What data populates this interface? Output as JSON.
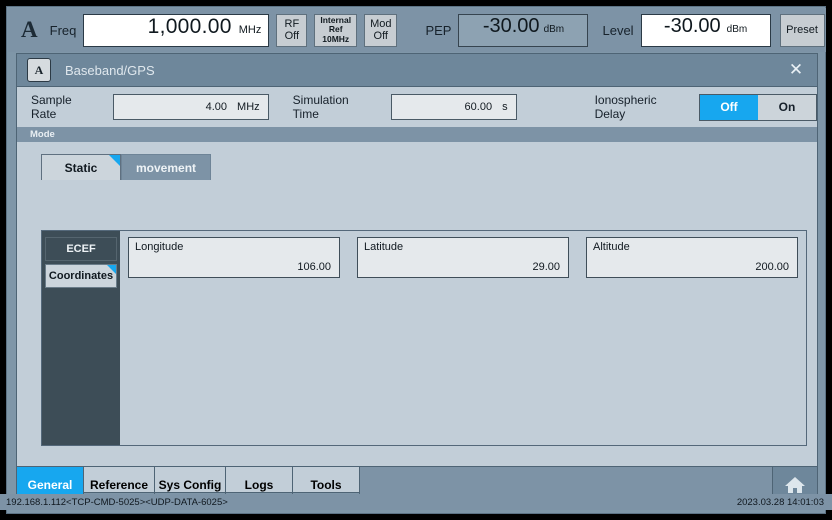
{
  "topbar": {
    "channel": "A",
    "freq_label": "Freq",
    "freq_value": "1,000.00",
    "freq_unit": "MHz",
    "rf_btn": "RF\nOff",
    "rf_line1": "RF",
    "rf_line2": "Off",
    "ref_line1": "Internal",
    "ref_line2": "Ref",
    "ref_line3": "10MHz",
    "mod_line1": "Mod",
    "mod_line2": "Off",
    "pep_label": "PEP",
    "pep_value": "-30.00",
    "pep_unit": "dBm",
    "level_label": "Level",
    "level_value": "-30.00",
    "level_unit": "dBm",
    "preset_label": "Preset"
  },
  "dialog": {
    "badge": "A",
    "title": "Baseband/GPS",
    "close_icon": "✕"
  },
  "settings": {
    "sample_rate_label": "Sample Rate",
    "sample_rate_value": "4.00",
    "sample_rate_unit": "MHz",
    "sim_time_label": "Simulation Time",
    "sim_time_value": "60.00",
    "sim_time_unit": "s",
    "iono_label": "Ionospheric Delay",
    "iono_off": "Off",
    "iono_on": "On",
    "iono_selected": "Off"
  },
  "mode": {
    "header": "Mode",
    "tabs": [
      {
        "label": "Static",
        "active": true
      },
      {
        "label": "movement",
        "active": false
      }
    ]
  },
  "sidetabs": [
    {
      "label": "ECEF",
      "active": false
    },
    {
      "label": "Coordinates",
      "active": true
    }
  ],
  "fields": [
    {
      "caption": "Longitude",
      "value": "106.00"
    },
    {
      "caption": "Latitude",
      "value": "29.00"
    },
    {
      "caption": "Altitude",
      "value": "200.00"
    }
  ],
  "waveform_button": {
    "icon": "waveform-icon"
  },
  "bottom_tabs": [
    {
      "label": "General",
      "active": true
    },
    {
      "label": "Reference",
      "active": false
    },
    {
      "label": "Sys Config",
      "active": false
    },
    {
      "label": "Logs",
      "active": false
    },
    {
      "label": "Tools",
      "active": false
    }
  ],
  "home_button": {
    "icon": "home-icon"
  },
  "statusbar": {
    "connection": "192.168.1.112<TCP-CMD-5025><UDP-DATA-6025>",
    "datetime": "2023.03.28 14:01:03"
  },
  "colors": {
    "accent": "#17a7ef",
    "panel": "#c2ced8",
    "chrome": "#7d93a6",
    "dark_sidebar": "#3d4d57"
  }
}
